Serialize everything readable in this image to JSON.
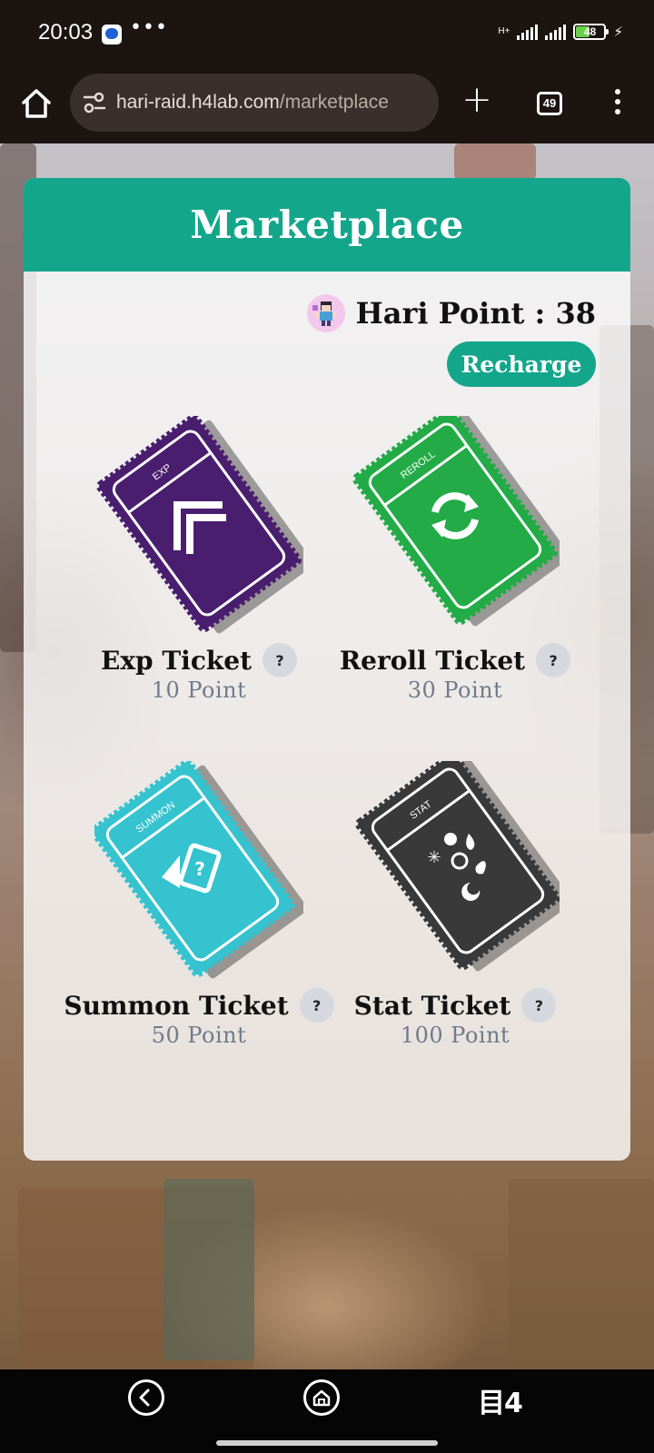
{
  "status_bar": {
    "time": "20:03",
    "more": "•••",
    "network": "H+",
    "battery": "48",
    "icons": [
      "messages-app-icon",
      "signal-icon",
      "battery-icon",
      "charging-icon"
    ]
  },
  "browser": {
    "url_host": "hari-raid.h4lab.com",
    "url_path": "/marketplace",
    "tab_count": "49",
    "plus": "+"
  },
  "marketplace": {
    "title": "Marketplace",
    "points_label": "Hari Point : 38",
    "recharge_label": "Recharge",
    "help_label": "?",
    "items": [
      {
        "name": "Exp Ticket",
        "price": "10 Point",
        "stub_label": "EXP",
        "color": "#4a1e6e"
      },
      {
        "name": "Reroll Ticket",
        "price": "30 Point",
        "stub_label": "REROLL",
        "color": "#22ab46"
      },
      {
        "name": "Summon Ticket",
        "price": "50 Point",
        "stub_label": "SUMMON",
        "color": "#34c3cf"
      },
      {
        "name": "Stat Ticket",
        "price": "100 Point",
        "stub_label": "STAT",
        "color": "#393939"
      }
    ]
  },
  "nav_bar": {
    "brand": "目4"
  },
  "colors": {
    "accent": "#13a68b",
    "price_text": "#6f7b8a"
  }
}
